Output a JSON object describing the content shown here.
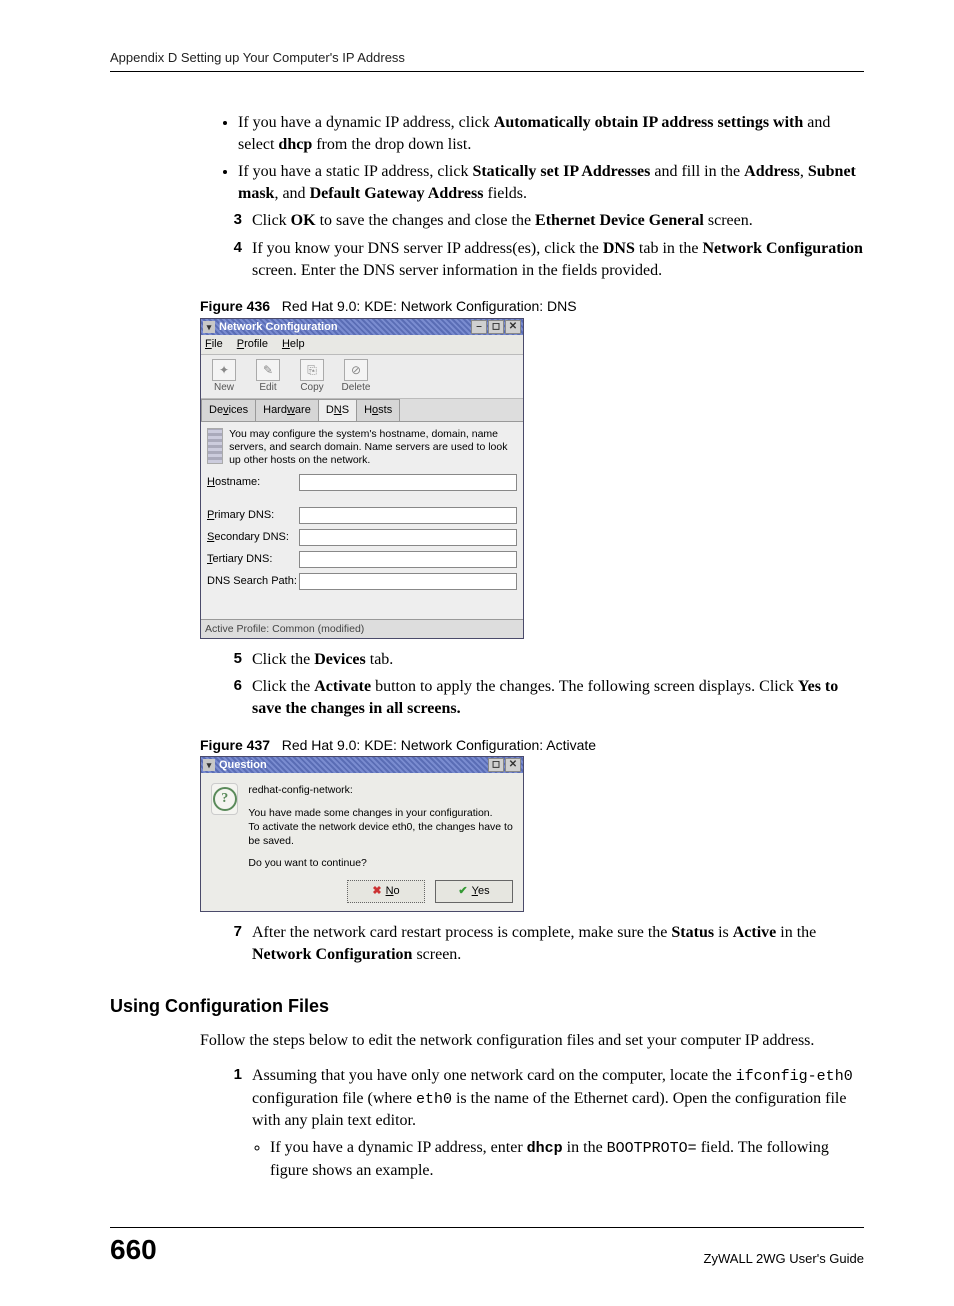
{
  "header": "Appendix D Setting up Your Computer's IP Address",
  "bullets_top": [
    {
      "pre": "If you have a dynamic IP address, click ",
      "b1": "Automatically obtain IP address settings with",
      "mid": " and select ",
      "b2": "dhcp",
      "post": " from the drop down list."
    },
    {
      "pre": "If you have a static IP address, click ",
      "b1": "Statically set IP Addresses",
      "mid": " and fill in the ",
      "b2": "Address",
      "mid2": ", ",
      "b3": "Subnet mask",
      "mid3": ", and ",
      "b4": "Default Gateway Address",
      "post": " fields."
    }
  ],
  "steps_a": [
    {
      "n": "3",
      "pre": "Click ",
      "b1": "OK",
      "mid": " to save the changes and close the ",
      "b2": "Ethernet Device General",
      "post": " screen."
    },
    {
      "n": "4",
      "pre": "If you know your DNS server IP address(es), click the ",
      "b1": "DNS",
      "mid": " tab in the ",
      "b2": "Network Configuration",
      "post": " screen. Enter the DNS server information in the fields provided."
    }
  ],
  "fig436": {
    "caption_num": "Figure 436",
    "caption_txt": "Red Hat 9.0: KDE: Network Configuration: DNS",
    "title": "Network Configuration",
    "menu": {
      "file": "File",
      "profile": "Profile",
      "help": "Help"
    },
    "toolbar": {
      "new": "New",
      "edit": "Edit",
      "copy": "Copy",
      "delete": "Delete"
    },
    "tabs": {
      "devices": "Devices",
      "hardware": "Hardware",
      "dns": "DNS",
      "hosts": "Hosts"
    },
    "desc": "You may configure the system's hostname, domain, name servers, and search domain. Name servers are used to look up other hosts on the network.",
    "labels": {
      "hostname": "Hostname:",
      "primary": "Primary DNS:",
      "secondary": "Secondary DNS:",
      "tertiary": "Tertiary DNS:",
      "search": "DNS Search Path:"
    },
    "status": "Active Profile: Common (modified)"
  },
  "steps_b": [
    {
      "n": "5",
      "pre": "Click the ",
      "b1": "Devices",
      "post": " tab."
    },
    {
      "n": "6",
      "pre": "Click the ",
      "b1": "Activate",
      "mid": " button to apply the changes. The following screen displays. Click ",
      "b2": "Yes to save the changes in all screens.",
      "post": ""
    }
  ],
  "fig437": {
    "caption_num": "Figure 437",
    "caption_txt": "Red Hat 9.0: KDE: Network Configuration: Activate",
    "title": "Question",
    "line1": "redhat-config-network:",
    "line2": "You have made some changes in your configuration.",
    "line3": "To activate the network device eth0, the changes have to be saved.",
    "line4": "Do you want to continue?",
    "no": "No",
    "yes": "Yes"
  },
  "steps_c": [
    {
      "n": "7",
      "pre": "After the network card restart process is complete, make sure the ",
      "b1": "Status",
      "mid": " is ",
      "b2": "Active",
      "mid2": " in the ",
      "b3": "Network Configuration",
      "post": " screen."
    }
  ],
  "section_heading": "Using Configuration Files",
  "section_para": "Follow the steps below to edit the network configuration files and set your computer IP address.",
  "steps_d": {
    "n": "1",
    "pre": "Assuming that you have only one network card on the computer, locate the ",
    "code1": "ifconfig-eth0",
    "mid": " configuration file (where ",
    "code2": "eth0",
    "mid2": " is the name of the Ethernet card). Open the configuration file with any plain text editor.",
    "bullet_pre": "If you have a dynamic IP address, enter ",
    "bullet_b": "dhcp",
    "bullet_mid": " in the ",
    "bullet_code": "BOOTPROTO=",
    "bullet_post": " field.  The following figure shows an example."
  },
  "footer": {
    "page": "660",
    "guide": "ZyWALL 2WG User's Guide"
  }
}
